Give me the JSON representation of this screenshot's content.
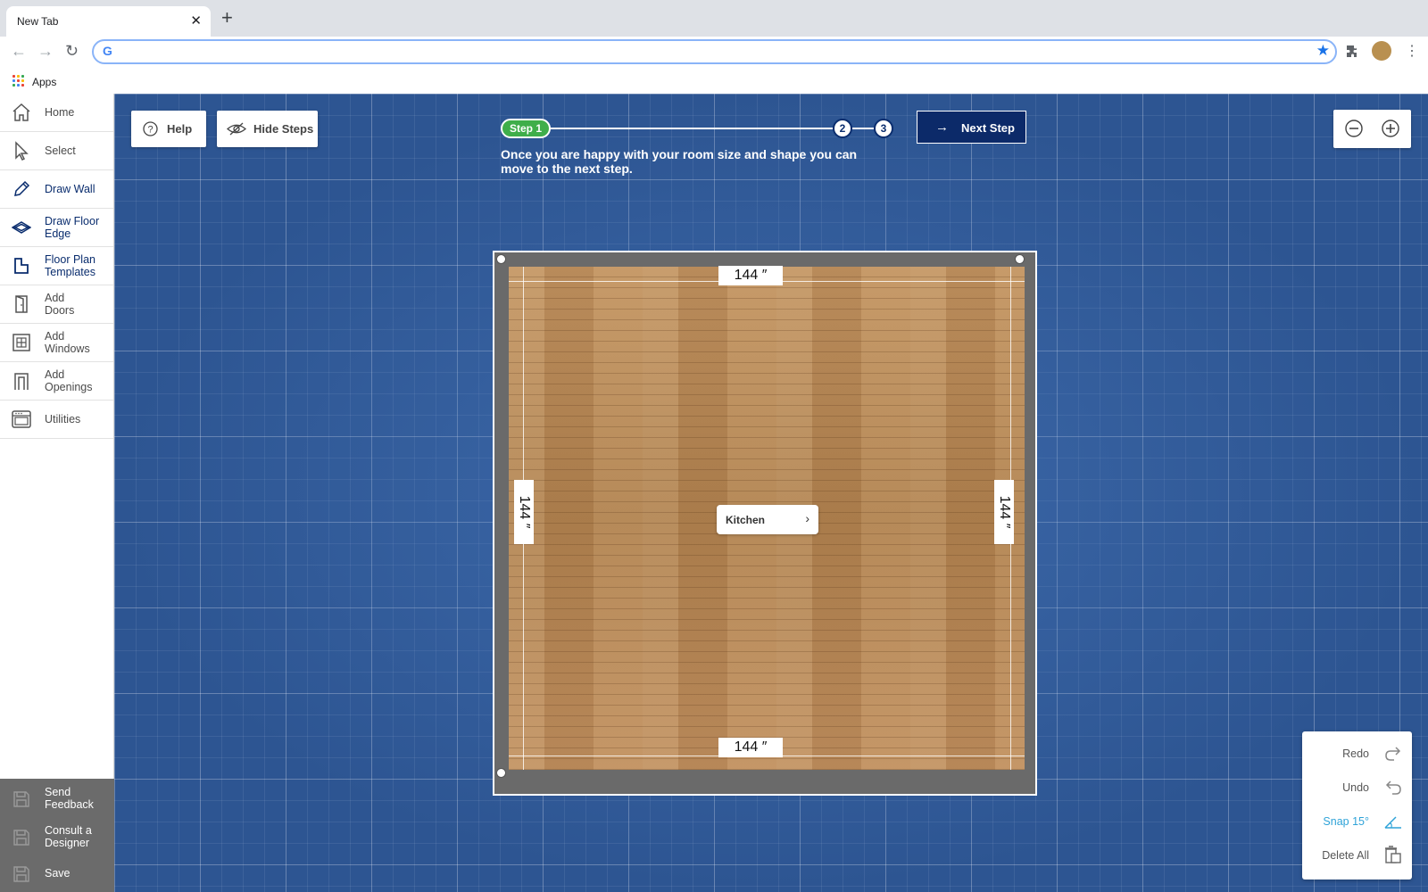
{
  "browser": {
    "tab_title": "New Tab",
    "tab_close": "✕",
    "new_tab": "+",
    "omnibox_value": "",
    "bookmarks": {
      "apps_label": "Apps"
    }
  },
  "sidebar": {
    "items": [
      {
        "label": "Home",
        "icon": "home-icon"
      },
      {
        "label": "Select",
        "icon": "cursor-icon"
      },
      {
        "label": "Draw Wall",
        "icon": "pencil-icon"
      },
      {
        "label": "Draw Floor\nEdge",
        "icon": "floor-layers-icon"
      },
      {
        "label": "Floor Plan\nTemplates",
        "icon": "template-icon"
      },
      {
        "label": "Add\nDoors",
        "icon": "door-icon"
      },
      {
        "label": "Add\nWindows",
        "icon": "window-icon"
      },
      {
        "label": "Add\nOpenings",
        "icon": "opening-icon"
      },
      {
        "label": "Utilities",
        "icon": "oven-icon"
      }
    ],
    "bottom": [
      {
        "label": "Send\nFeedback",
        "icon": "save-icon"
      },
      {
        "label": "Consult a\nDesigner",
        "icon": "save-icon"
      },
      {
        "label": "Save",
        "icon": "save-icon"
      }
    ]
  },
  "toolbar": {
    "help_label": "Help",
    "hide_steps_label": "Hide Steps",
    "next_step_label": "Next Step"
  },
  "stepper": {
    "step1_label": "Step 1",
    "step2_label": "2",
    "step3_label": "3",
    "current_step": 1,
    "description": "Once you are happy with your room size and shape you can move to the next step."
  },
  "room": {
    "name": "Kitchen",
    "top_dim": "144 ″",
    "bottom_dim": "144 ″",
    "left_dim": "144 ″",
    "right_dim": "144 ″"
  },
  "actions": {
    "redo_label": "Redo",
    "undo_label": "Undo",
    "snap_label": "Snap 15°",
    "delete_all_label": "Delete All",
    "snap_color": "#2fa3d8"
  },
  "colors": {
    "canvas_blue": "#2d5592",
    "nav_navy": "#0c2a69",
    "step_green": "#3fae4a",
    "sidebar_bottom": "#6b6b6b"
  }
}
